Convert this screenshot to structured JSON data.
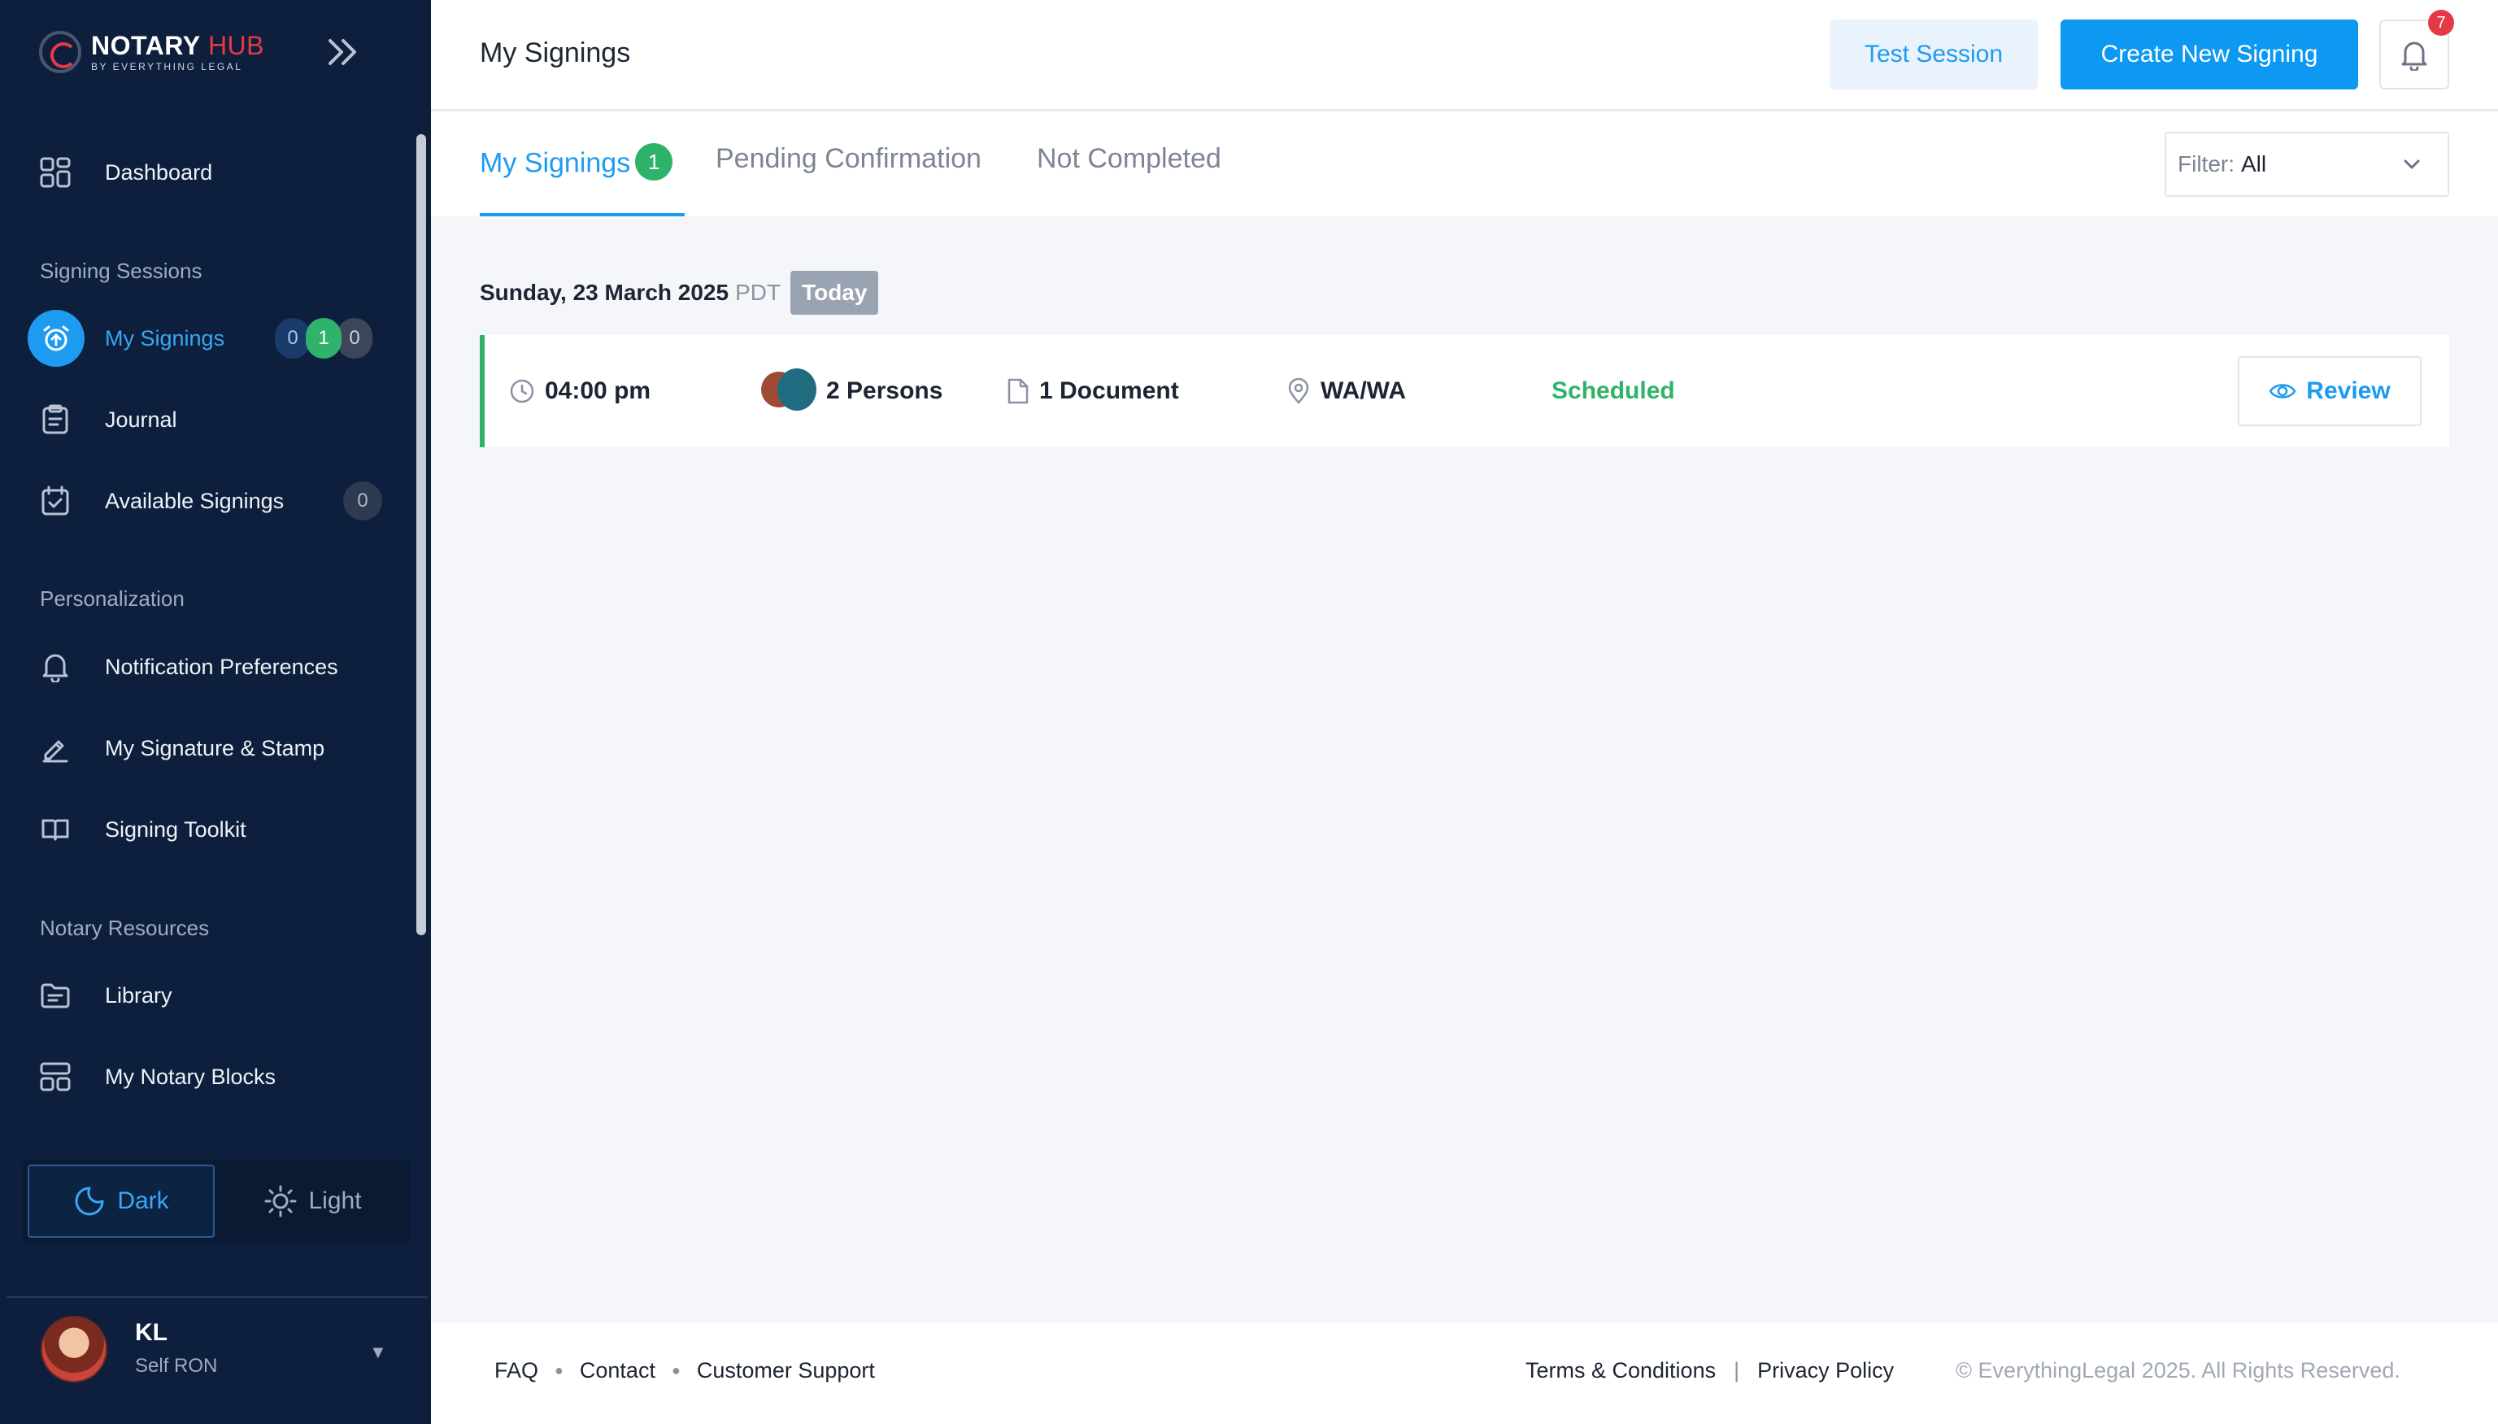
{
  "brand": {
    "name_a": "NOTARY",
    "name_b": " HUB",
    "subtitle": "BY EVERYTHING LEGAL"
  },
  "sidebar": {
    "dashboard": "Dashboard",
    "section_signing": "Signing Sessions",
    "my_signings": "My Signings",
    "my_signings_counts": [
      "0",
      "1",
      "0"
    ],
    "journal": "Journal",
    "available_signings": "Available Signings",
    "available_count": "0",
    "section_personalization": "Personalization",
    "notification_prefs": "Notification Preferences",
    "signature_stamp": "My Signature & Stamp",
    "signing_toolkit": "Signing Toolkit",
    "section_resources": "Notary Resources",
    "library": "Library",
    "notary_blocks": "My Notary Blocks"
  },
  "theme": {
    "dark": "Dark",
    "light": "Light",
    "selected": "dark"
  },
  "user": {
    "initials": "KL",
    "role": "Self RON"
  },
  "header": {
    "title": "My Signings",
    "test_session": "Test Session",
    "create_new": "Create New Signing",
    "notification_count": "7"
  },
  "tabs": [
    {
      "label": "My Signings",
      "badge": "1"
    },
    {
      "label": "Pending Confirmation"
    },
    {
      "label": "Not Completed"
    }
  ],
  "filter": {
    "label": "Filter:",
    "value": "All"
  },
  "day_group": {
    "date": "Sunday, 23 March 2025",
    "tz": "PDT",
    "chip": "Today"
  },
  "signing": {
    "time": "04:00 pm",
    "persons": "2 Persons",
    "documents": "1 Document",
    "location": "WA/WA",
    "status": "Scheduled",
    "action": "Review"
  },
  "footer": {
    "faq": "FAQ",
    "contact": "Contact",
    "support": "Customer Support",
    "terms": "Terms & Conditions",
    "privacy": "Privacy Policy",
    "copyright": "© EverythingLegal 2025. All Rights Reserved."
  },
  "colors": {
    "sidebar_bg": "#0d1f3c",
    "accent": "#1d9bf0",
    "success": "#2fb36b",
    "danger": "#e53a46"
  }
}
